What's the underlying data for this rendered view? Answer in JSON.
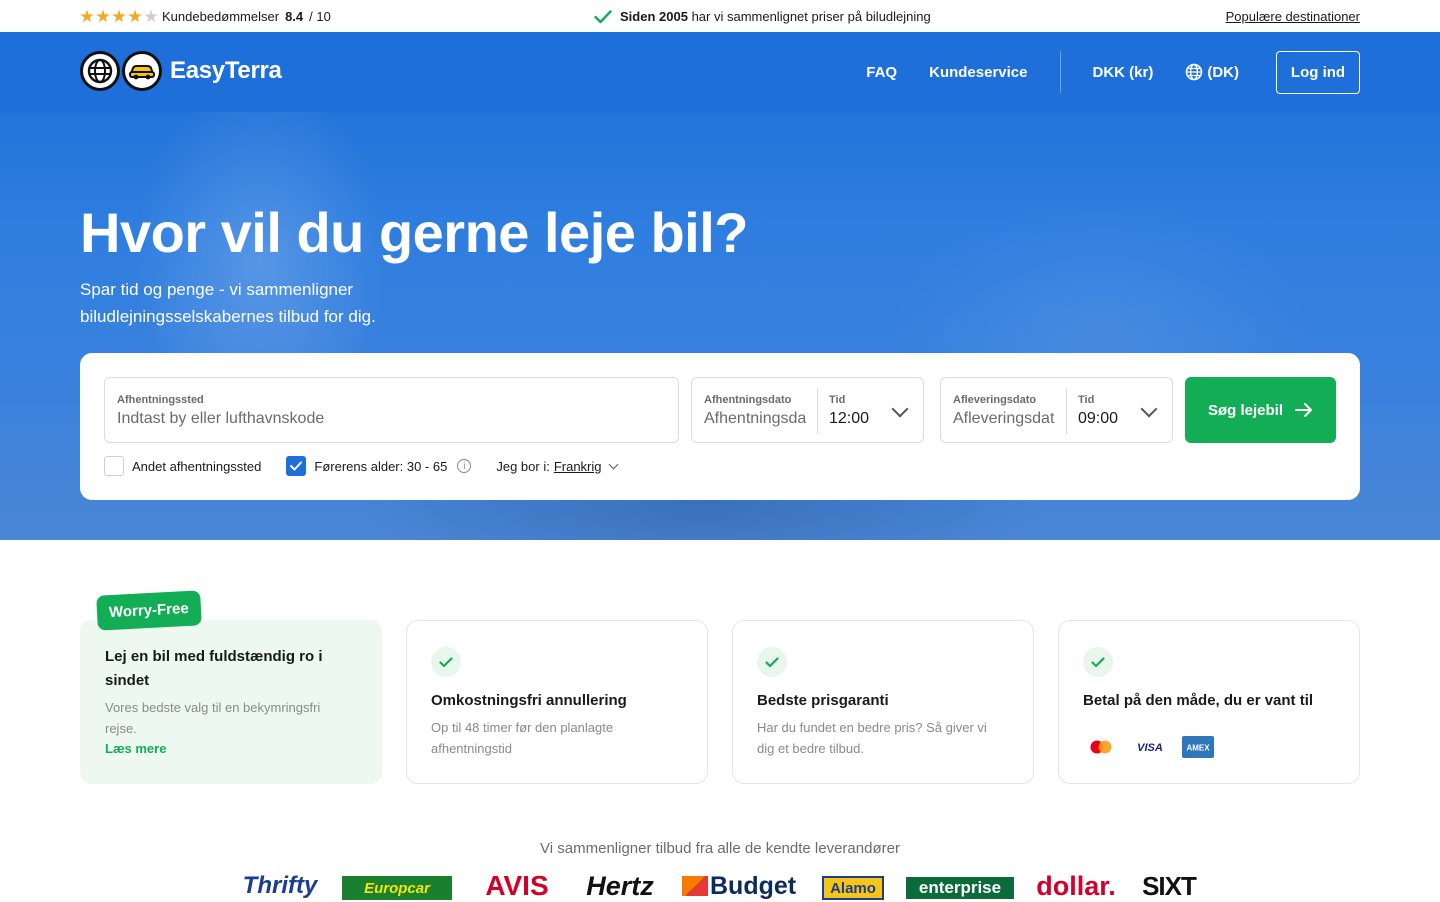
{
  "topbar": {
    "rating_label": "Kundebedømmelser",
    "rating_value": "8.4",
    "rating_suffix": "/ 10",
    "stars_filled": 4,
    "stars_total": 5,
    "since_bold": "Siden 2005",
    "since_rest": "har vi sammenlignet priser på biludlejning",
    "popular_link": "Populære destinationer"
  },
  "nav": {
    "brand": "EasyTerra",
    "faq": "FAQ",
    "customer_service": "Kundeservice",
    "currency": "DKK (kr)",
    "language": "(DK)",
    "login": "Log ind"
  },
  "hero": {
    "title": "Hvor vil du gerne leje bil?",
    "subtitle": "Spar tid og penge - vi sammenligner biludlejningsselskabernes tilbud for dig."
  },
  "search": {
    "pickup_location_label": "Afhentningssted",
    "pickup_location_placeholder": "Indtast by eller lufthavnskode",
    "pickup_date_label": "Afhentningsdato",
    "pickup_date_placeholder": "Afhentningsda",
    "pickup_time_label": "Tid",
    "pickup_time_value": "12:00",
    "dropoff_date_label": "Afleveringsdato",
    "dropoff_date_placeholder": "Afleveringsdat",
    "dropoff_time_label": "Tid",
    "dropoff_time_value": "09:00",
    "search_button": "Søg lejebil",
    "other_dropoff_label": "Andet afhentningssted",
    "other_dropoff_checked": false,
    "driver_age_label": "Førerens alder: 30 - 65",
    "driver_age_checked": true,
    "residence_label": "Jeg bor i:",
    "residence_value": "Frankrig"
  },
  "features": [
    {
      "badge": "Worry-Free",
      "title": "Lej en bil med fuldstændig ro i sindet",
      "desc": "Vores bedste valg til en bekymringsfri rejse.",
      "link": "Læs mere"
    },
    {
      "title": "Omkostningsfri annullering",
      "desc": "Op til 48 timer før den planlagte afhentningstid"
    },
    {
      "title": "Bedste prisgaranti",
      "desc": "Har du fundet en bedre pris? Så giver vi dig et bedre tilbud."
    },
    {
      "title": "Betal på den måde, du er vant til",
      "payments": [
        "mastercard",
        "VISA",
        "AMEX"
      ]
    }
  ],
  "providers": {
    "title": "Vi sammenligner tilbud fra alle de kendte leverandører",
    "brands": [
      "Thrifty",
      "Europcar",
      "AVIS",
      "Hertz",
      "Budget",
      "Alamo",
      "enterprise",
      "dollar.",
      "SIXT"
    ]
  },
  "colors": {
    "primary_blue": "#1e6fd9",
    "accent_green": "#13ad55",
    "star_gold": "#f5a623"
  }
}
